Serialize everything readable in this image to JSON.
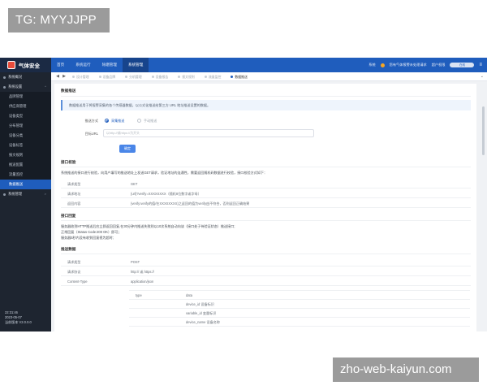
{
  "watermarks": {
    "top": "TG: MYYJJPP",
    "bottom": "zho-web-kaiyun.com"
  },
  "app": {
    "brand": "气体安全",
    "nav": [
      "首页",
      "系统运行",
      "除磨管理",
      "系统管理"
    ],
    "nav_active_index": 3,
    "top_right": {
      "user": "系统",
      "notice": "您有气体报警未处理请求",
      "admin": "超户权限",
      "pill": "在线",
      "menu": "≡"
    }
  },
  "sidebar": {
    "items": [
      {
        "label": "系统概况",
        "kind": "group",
        "arrow": ""
      },
      {
        "label": "系统设置",
        "kind": "group",
        "arrow": "^"
      },
      {
        "label": "品牌管理",
        "kind": "sub"
      },
      {
        "label": "供应商管理",
        "kind": "sub"
      },
      {
        "label": "设备类型",
        "kind": "sub"
      },
      {
        "label": "分布管理",
        "kind": "sub"
      },
      {
        "label": "设备分类",
        "kind": "sub"
      },
      {
        "label": "设备标签",
        "kind": "sub"
      },
      {
        "label": "报文规则",
        "kind": "sub"
      },
      {
        "label": "推送配置",
        "kind": "sub"
      },
      {
        "label": "流量监控",
        "kind": "sub"
      },
      {
        "label": "数据推送",
        "kind": "sub",
        "active": true
      },
      {
        "label": "系统管理",
        "kind": "group",
        "arrow": ">"
      }
    ],
    "footer": {
      "time": "22:31:46",
      "date": "2023-05-07",
      "version": "当前版本 V2.0.0.0"
    }
  },
  "tabs": {
    "left_arrow": "◀",
    "right_arrow": "▶",
    "items": [
      "设计管理",
      "设备品牌",
      "分机管理",
      "设备报告",
      "报文规则",
      "流量监控",
      "数据推送"
    ],
    "active_index": 6,
    "more": "⌄"
  },
  "page": {
    "section1_title": "数据推送",
    "notice": "数据推送用于将报警采集的各个传感器数据，以公式化推送给第三方 URL 地址推送设置的数据。",
    "push_label": "推送方式",
    "push_options": [
      "采集推送",
      "手动推送"
    ],
    "push_selected_index": 0,
    "url_label": "目标URL",
    "url_placeholder": "以http://或https://为开头",
    "confirm_button": "确定",
    "section2_title": "接口校验",
    "section2_desc": "系统推送的接口进行校验，向用户填写的推送地址上发送GET请求，验证地址的连通性，需要返回随机码数据进行校验，接口校验方式如下：",
    "verify_rows": [
      {
        "k": "请求类型",
        "v": "GET"
      },
      {
        "k": "请求地址",
        "v": "{url}?verify=XXXXXXXX（随机8位数字或字母）"
      },
      {
        "k": "返回内容",
        "v": "{verify:verify的值/在XXXXXXXX}之返回的值为verify由不符合，否则返回正确结果"
      }
    ],
    "section3_title": "接口回复",
    "section3_lines": [
      "服务器收到HTTP推送后应立即返回回复,在30分钟内推送失败则以10次系统自动向该（接口处于待验证状态）推送接口;",
      "正常回复（Status Code:200 OK）即可；",
      "服务器5秒内没有收到回复视为超时;"
    ],
    "section4_title": "推送数据",
    "data_rows": [
      {
        "k": "请求类型",
        "v": "POST"
      },
      {
        "k": "请求协议",
        "v": "http:// 或 https://"
      },
      {
        "k": "Content-Type",
        "v": "application/json"
      }
    ],
    "sub_rows": [
      {
        "k": "type",
        "v": "data"
      },
      {
        "k": "",
        "v": "device_id 设备标识"
      },
      {
        "k": "",
        "v": "variable_id 变量标识"
      },
      {
        "k": "",
        "v": "device_name 设备名称"
      }
    ]
  }
}
